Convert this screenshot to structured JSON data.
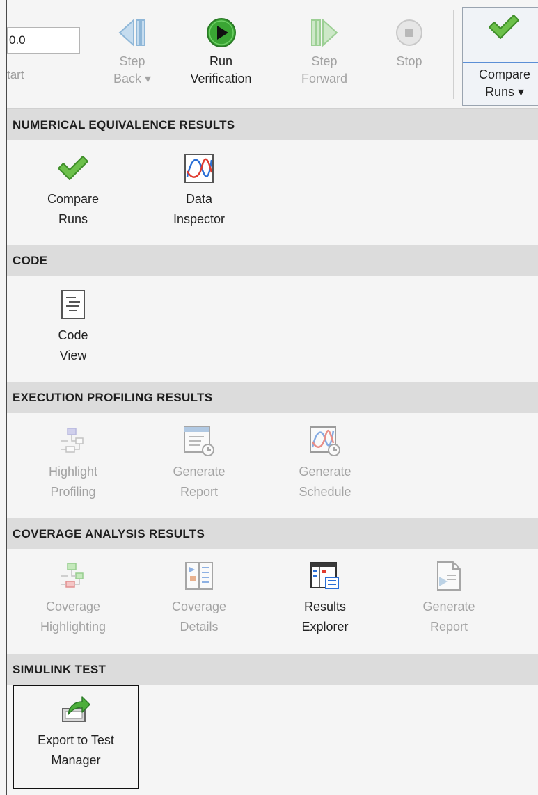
{
  "toolbar": {
    "stop_time_value": "0.0",
    "start_label": "tart",
    "step_back": {
      "line1": "Step",
      "line2": "Back ▾"
    },
    "run_verification": {
      "line1": "Run",
      "line2": "Verification"
    },
    "step_forward": {
      "line1": "Step",
      "line2": "Forward"
    },
    "stop": {
      "line1": "Stop"
    },
    "compare_runs": {
      "line1": "Compare",
      "line2": "Runs ▾"
    }
  },
  "sections": {
    "numerical": {
      "header": "NUMERICAL EQUIVALENCE RESULTS",
      "compare_runs": {
        "line1": "Compare",
        "line2": "Runs"
      },
      "data_inspector": {
        "line1": "Data",
        "line2": "Inspector"
      }
    },
    "code": {
      "header": "CODE",
      "code_view": {
        "line1": "Code",
        "line2": "View"
      }
    },
    "profiling": {
      "header": "EXECUTION PROFILING RESULTS",
      "highlight_profiling": {
        "line1": "Highlight",
        "line2": "Profiling"
      },
      "generate_report": {
        "line1": "Generate",
        "line2": "Report"
      },
      "generate_schedule": {
        "line1": "Generate",
        "line2": "Schedule"
      }
    },
    "coverage": {
      "header": "COVERAGE ANALYSIS RESULTS",
      "coverage_highlighting": {
        "line1": "Coverage",
        "line2": "Highlighting"
      },
      "coverage_details": {
        "line1": "Coverage",
        "line2": "Details"
      },
      "results_explorer": {
        "line1": "Results",
        "line2": "Explorer"
      },
      "generate_report": {
        "line1": "Generate",
        "line2": "Report"
      }
    },
    "simulink_test": {
      "header": "SIMULINK TEST",
      "export_to_test_manager": {
        "line1": "Export to Test",
        "line2": "Manager"
      }
    }
  },
  "colors": {
    "check_green": "#6cc04a",
    "run_green": "#3aa534",
    "disabled_text": "#a3a3a3",
    "header_bg": "#dcdcdc",
    "accent_blue": "#5b8fd6"
  },
  "icons": [
    "step-back-icon",
    "run-verification-icon",
    "step-forward-icon",
    "stop-icon",
    "check-icon",
    "data-inspector-icon",
    "code-view-icon",
    "highlight-profiling-icon",
    "generate-report-icon",
    "generate-schedule-icon",
    "coverage-highlighting-icon",
    "coverage-details-icon",
    "results-explorer-icon",
    "export-test-manager-icon"
  ]
}
